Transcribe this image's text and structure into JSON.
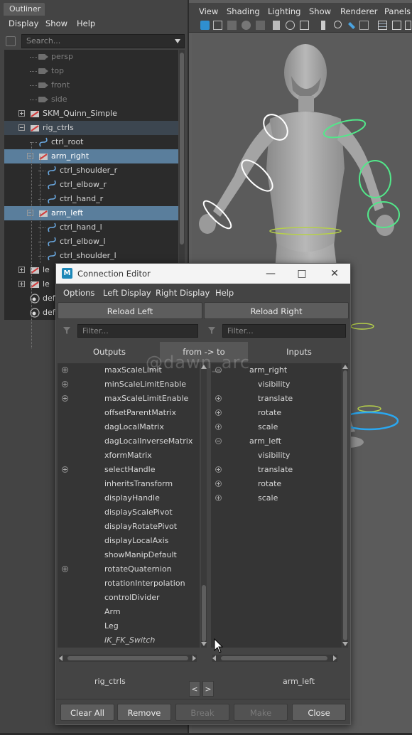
{
  "outliner": {
    "tab": "Outliner",
    "menu": [
      "Display",
      "Show",
      "Help"
    ],
    "search_placeholder": "Search...",
    "rows": [
      {
        "label": "persp",
        "kind": "camera"
      },
      {
        "label": "top",
        "kind": "camera"
      },
      {
        "label": "front",
        "kind": "camera"
      },
      {
        "label": "side",
        "kind": "camera"
      },
      {
        "label": "SKM_Quinn_Simple",
        "kind": "joint"
      },
      {
        "label": "rig_ctrls",
        "kind": "group"
      },
      {
        "label": "ctrl_root",
        "kind": "curve"
      },
      {
        "label": "arm_right",
        "kind": "group"
      },
      {
        "label": "ctrl_shoulder_r",
        "kind": "curve"
      },
      {
        "label": "ctrl_elbow_r",
        "kind": "curve"
      },
      {
        "label": "ctrl_hand_r",
        "kind": "curve"
      },
      {
        "label": "arm_left",
        "kind": "group"
      },
      {
        "label": "ctrl_hand_l",
        "kind": "curve"
      },
      {
        "label": "ctrl_elbow_l",
        "kind": "curve"
      },
      {
        "label": "ctrl_shoulder_l",
        "kind": "curve"
      },
      {
        "label": "le",
        "kind": "group"
      },
      {
        "label": "le",
        "kind": "group"
      },
      {
        "label": "defa",
        "kind": "set"
      },
      {
        "label": "defa",
        "kind": "set"
      }
    ]
  },
  "viewport": {
    "menu": [
      "View",
      "Shading",
      "Lighting",
      "Show",
      "Renderer",
      "Panels"
    ]
  },
  "connection_editor": {
    "title": "Connection Editor",
    "logo_letter": "M",
    "menu": [
      "Options",
      "Left Display",
      "Right Display",
      "Help"
    ],
    "reload_left": "Reload Left",
    "reload_right": "Reload Right",
    "filter_placeholder": "Filter...",
    "outputs_label": "Outputs",
    "direction_label": "from -> to",
    "inputs_label": "Inputs",
    "watermark": "@dawn_arc",
    "left_items": [
      {
        "label": "maxScaleLimit",
        "plus": true,
        "italic": false
      },
      {
        "label": "minScaleLimitEnable",
        "plus": true,
        "italic": false
      },
      {
        "label": "maxScaleLimitEnable",
        "plus": true,
        "italic": false
      },
      {
        "label": "offsetParentMatrix",
        "plus": false,
        "italic": false
      },
      {
        "label": "dagLocalMatrix",
        "plus": false,
        "italic": false
      },
      {
        "label": "dagLocalInverseMatrix",
        "plus": false,
        "italic": false
      },
      {
        "label": "xformMatrix",
        "plus": false,
        "italic": false
      },
      {
        "label": "selectHandle",
        "plus": true,
        "italic": false
      },
      {
        "label": "inheritsTransform",
        "plus": false,
        "italic": false
      },
      {
        "label": "displayHandle",
        "plus": false,
        "italic": false
      },
      {
        "label": "displayScalePivot",
        "plus": false,
        "italic": false
      },
      {
        "label": "displayRotatePivot",
        "plus": false,
        "italic": false
      },
      {
        "label": "displayLocalAxis",
        "plus": false,
        "italic": false
      },
      {
        "label": "showManipDefault",
        "plus": false,
        "italic": false
      },
      {
        "label": "rotateQuaternion",
        "plus": true,
        "italic": false
      },
      {
        "label": "rotationInterpolation",
        "plus": false,
        "italic": false
      },
      {
        "label": "controlDivider",
        "plus": false,
        "italic": false
      },
      {
        "label": "Arm",
        "plus": false,
        "italic": false
      },
      {
        "label": "Leg",
        "plus": false,
        "italic": false
      },
      {
        "label": "IK_FK_Switch",
        "plus": false,
        "italic": true
      }
    ],
    "right_items": [
      {
        "label": "arm_right",
        "icon": "minus",
        "indent": 0
      },
      {
        "label": "visibility",
        "icon": "none",
        "indent": 1
      },
      {
        "label": "translate",
        "icon": "plus",
        "indent": 1
      },
      {
        "label": "rotate",
        "icon": "plus",
        "indent": 1
      },
      {
        "label": "scale",
        "icon": "plus",
        "indent": 1
      },
      {
        "label": "arm_left",
        "icon": "minus",
        "indent": 0
      },
      {
        "label": "visibility",
        "icon": "none",
        "indent": 1
      },
      {
        "label": "translate",
        "icon": "plus",
        "indent": 1
      },
      {
        "label": "rotate",
        "icon": "plus",
        "indent": 1
      },
      {
        "label": "scale",
        "icon": "plus",
        "indent": 1
      }
    ],
    "left_node": "rig_ctrls",
    "right_node": "arm_left",
    "swap_left": "<",
    "swap_right": ">",
    "buttons": {
      "clear_all": "Clear All",
      "remove": "Remove",
      "break": "Break",
      "make": "Make",
      "close": "Close"
    }
  },
  "colors": {
    "selection": "#5a7e9c",
    "panel": "#444444",
    "list_bg": "#353535",
    "maya_blue": "#1d88b8"
  }
}
